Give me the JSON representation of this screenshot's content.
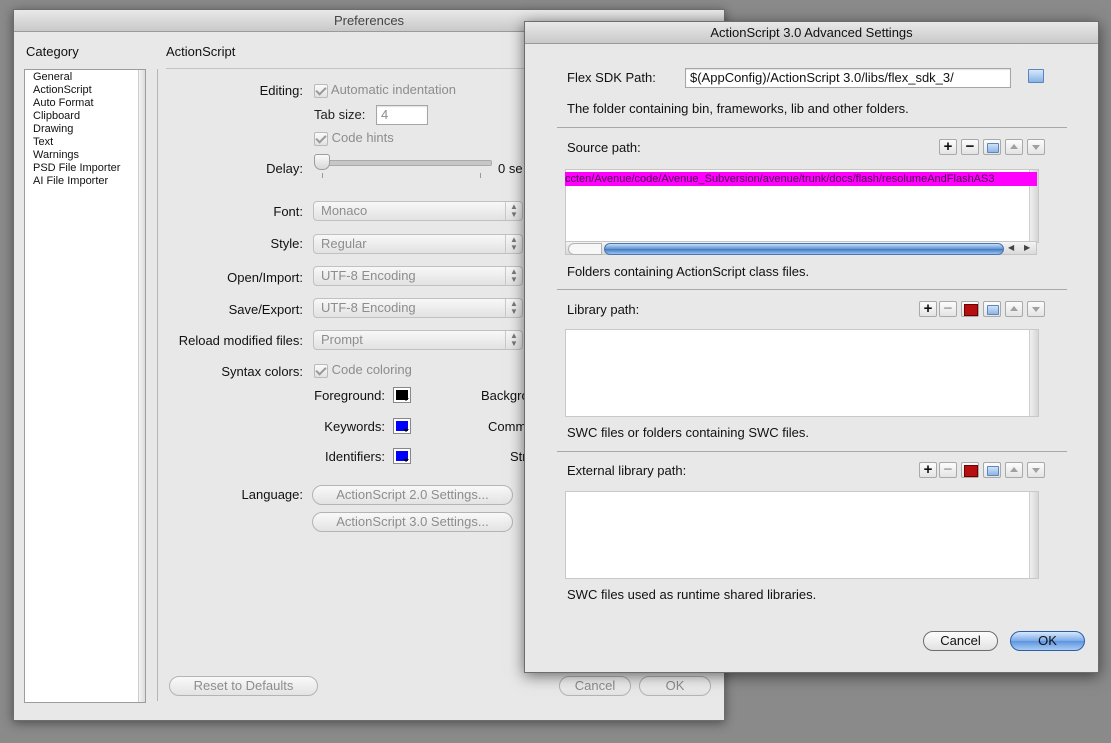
{
  "prefs": {
    "title": "Preferences",
    "category_title": "Category",
    "categories": [
      "General",
      "ActionScript",
      "Auto Format",
      "Clipboard",
      "Drawing",
      "Text",
      "Warnings",
      "PSD File Importer",
      "AI File Importer"
    ],
    "section_title": "ActionScript",
    "editing_label": "Editing:",
    "auto_indent": "Automatic indentation",
    "tab_size_label": "Tab size:",
    "tab_size_value": "4",
    "code_hints": "Code hints",
    "delay_label": "Delay:",
    "delay_value": "0 se",
    "font_label": "Font:",
    "font_value": "Monaco",
    "style_label": "Style:",
    "style_value": "Regular",
    "open_import_label": "Open/Import:",
    "open_import_value": "UTF-8 Encoding",
    "save_export_label": "Save/Export:",
    "save_export_value": "UTF-8 Encoding",
    "reload_label": "Reload modified files:",
    "reload_value": "Prompt",
    "syntax_label": "Syntax colors:",
    "code_coloring": "Code coloring",
    "foreground_label": "Foreground:",
    "background_label": "Backgro",
    "keywords_label": "Keywords:",
    "comments_label": "Comm",
    "identifiers_label": "Identifiers:",
    "strings_label": "Str",
    "language_label": "Language:",
    "as2_button": "ActionScript 2.0 Settings...",
    "as3_button": "ActionScript 3.0 Settings...",
    "reset_button": "Reset to Defaults",
    "cancel_button": "Cancel",
    "ok_button": "OK",
    "colors": {
      "foreground": "#000000",
      "keywords": "#0000ff",
      "identifiers": "#0000ff"
    }
  },
  "advanced": {
    "title": "ActionScript 3.0 Advanced Settings",
    "sdk_label": "Flex SDK Path:",
    "sdk_value": "$(AppConfig)/ActionScript 3.0/libs/flex_sdk_3/",
    "sdk_hint": "The folder containing bin, frameworks, lib and other folders.",
    "source_label": "Source path:",
    "source_selected_row": "ccten/Avenue/code/Avenue_Subversion/avenue/trunk/docs/flash/resolumeAndFlashAS3",
    "source_hint": "Folders containing ActionScript class files.",
    "library_label": "Library path:",
    "library_hint": "SWC files or folders containing SWC files.",
    "external_label": "External library path:",
    "external_hint": "SWC files used as runtime shared libraries.",
    "cancel_button": "Cancel",
    "ok_button": "OK",
    "highlight_color": "#ff00ff",
    "add_symbol": "+",
    "remove_symbol": "−"
  }
}
